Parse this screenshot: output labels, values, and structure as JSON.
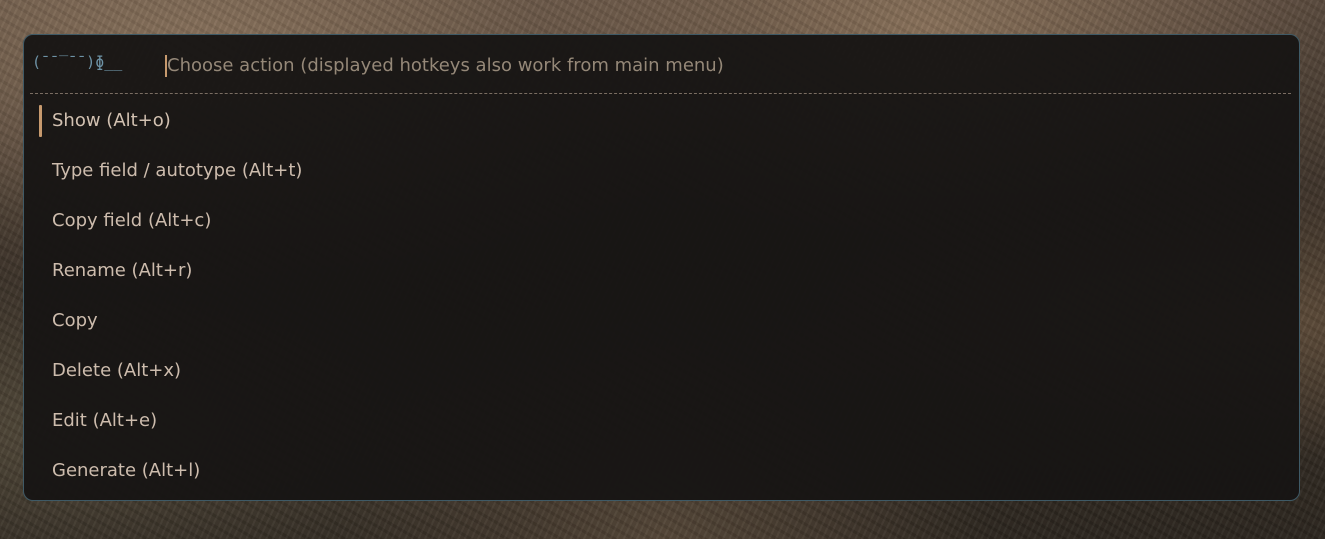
{
  "prompt": {
    "glyph": "(¯¯‾¯¯)ɸ__",
    "placeholder": "Choose action (displayed hotkeys also work from main menu)",
    "value": ""
  },
  "actions": [
    {
      "label": "Show (Alt+o)",
      "selected": true
    },
    {
      "label": "Type field / autotype (Alt+t)",
      "selected": false
    },
    {
      "label": "Copy field (Alt+c)",
      "selected": false
    },
    {
      "label": "Rename (Alt+r)",
      "selected": false
    },
    {
      "label": "Copy",
      "selected": false
    },
    {
      "label": "Delete (Alt+x)",
      "selected": false
    },
    {
      "label": "Edit (Alt+e)",
      "selected": false
    },
    {
      "label": "Generate (Alt+l)",
      "selected": false
    }
  ],
  "colors": {
    "accent": "#c79a6e",
    "border": "#3f5a66",
    "prompt_glyph": "#6e93a6",
    "text": "#cdbcad",
    "background": "#171514"
  }
}
